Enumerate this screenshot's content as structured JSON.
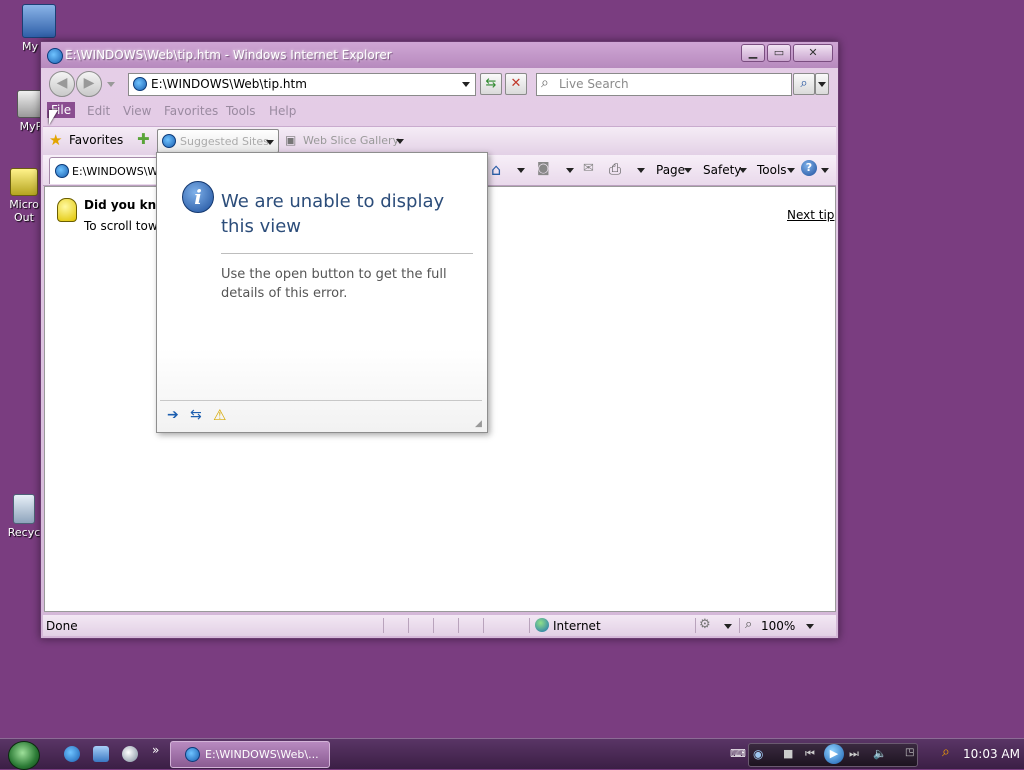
{
  "desktop": {
    "icons": [
      {
        "label": "My Co"
      },
      {
        "label": "MyP"
      },
      {
        "label": "Micro Out"
      },
      {
        "label": "Recyc"
      }
    ]
  },
  "window": {
    "title": "E:\\WINDOWS\\Web\\tip.htm - Windows Internet Explorer",
    "address": "E:\\WINDOWS\\Web\\tip.htm",
    "search_placeholder": "Live Search",
    "menu": [
      "File",
      "Edit",
      "View",
      "Favorites",
      "Tools",
      "Help"
    ],
    "favorites_label": "Favorites",
    "suggested_sites": "Suggested Sites",
    "web_slice_gallery": "Web Slice Gallery",
    "tab_label": "E:\\WINDOWS\\W",
    "commands": {
      "page": "Page",
      "safety": "Safety",
      "tools": "Tools"
    }
  },
  "content": {
    "tip_title": "Did you know",
    "tip_body": "To scroll towar",
    "next_tip": "Next tip"
  },
  "popup": {
    "heading": "We are unable to display this view",
    "body": "Use the open button to get the full details of this error."
  },
  "status": {
    "left": "Done",
    "zone": "Internet",
    "zoom": "100%"
  },
  "taskbar": {
    "task_label": "E:\\WINDOWS\\Web\\...",
    "clock": "10:03 AM"
  },
  "colors": {
    "desktop": "#7a3d80",
    "accent": "#8a4d90",
    "popup_heading": "#2c4d7a"
  }
}
